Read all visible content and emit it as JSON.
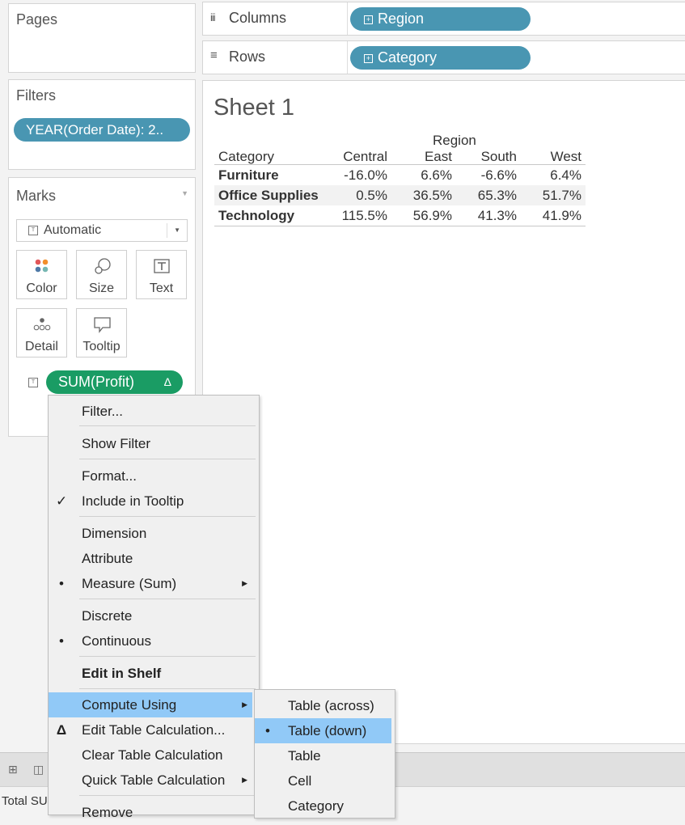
{
  "pages": {
    "title": "Pages"
  },
  "columns_shelf": {
    "label": "Columns",
    "pill": "Region"
  },
  "rows_shelf": {
    "label": "Rows",
    "pill": "Category"
  },
  "filters": {
    "title": "Filters",
    "pill": "YEAR(Order Date): 2.."
  },
  "marks": {
    "title": "Marks",
    "type": "Automatic",
    "buttons": [
      "Color",
      "Size",
      "Text",
      "Detail",
      "Tooltip"
    ],
    "measure_pill": "SUM(Profit)",
    "delta_symbol": "Δ"
  },
  "sheet": {
    "title": "Sheet 1",
    "col_group": "Region",
    "row_header": "Category",
    "columns": [
      "Central",
      "East",
      "South",
      "West"
    ],
    "rows": [
      {
        "category": "Furniture",
        "values": [
          "-16.0%",
          "6.6%",
          "-6.6%",
          "6.4%"
        ]
      },
      {
        "category": "Office Supplies",
        "values": [
          "0.5%",
          "36.5%",
          "65.3%",
          "51.7%"
        ]
      },
      {
        "category": "Technology",
        "values": [
          "115.5%",
          "56.9%",
          "41.3%",
          "41.9%"
        ]
      }
    ]
  },
  "context_menu": {
    "items": [
      {
        "label": "Filter...",
        "check": ""
      },
      {
        "label": "Show Filter",
        "check": ""
      },
      {
        "label": "Format...",
        "check": ""
      },
      {
        "label": "Include in Tooltip",
        "check": "✓"
      },
      {
        "label": "Dimension",
        "check": ""
      },
      {
        "label": "Attribute",
        "check": ""
      },
      {
        "label": "Measure (Sum)",
        "check": "•",
        "arrow": "▶"
      },
      {
        "label": "Discrete",
        "check": ""
      },
      {
        "label": "Continuous",
        "check": "•"
      },
      {
        "label": "Edit in Shelf",
        "check": ""
      },
      {
        "label": "Compute Using",
        "check": "",
        "arrow": "▶"
      },
      {
        "label": "Edit Table Calculation...",
        "check": "Δ"
      },
      {
        "label": "Clear Table Calculation",
        "check": ""
      },
      {
        "label": "Quick Table Calculation",
        "check": "",
        "arrow": "▶"
      },
      {
        "label": "Remove",
        "check": ""
      }
    ]
  },
  "submenu": {
    "items": [
      {
        "label": "Table (across)",
        "check": ""
      },
      {
        "label": "Table (down)",
        "check": "•"
      },
      {
        "label": "Table",
        "check": ""
      },
      {
        "label": "Cell",
        "check": ""
      },
      {
        "label": "Category",
        "check": ""
      }
    ]
  },
  "status": {
    "text": "Total SU"
  },
  "colors": {
    "pill_blue": "#4996b2",
    "pill_green": "#1a9c64",
    "menu_highlight": "#91c9f7"
  }
}
